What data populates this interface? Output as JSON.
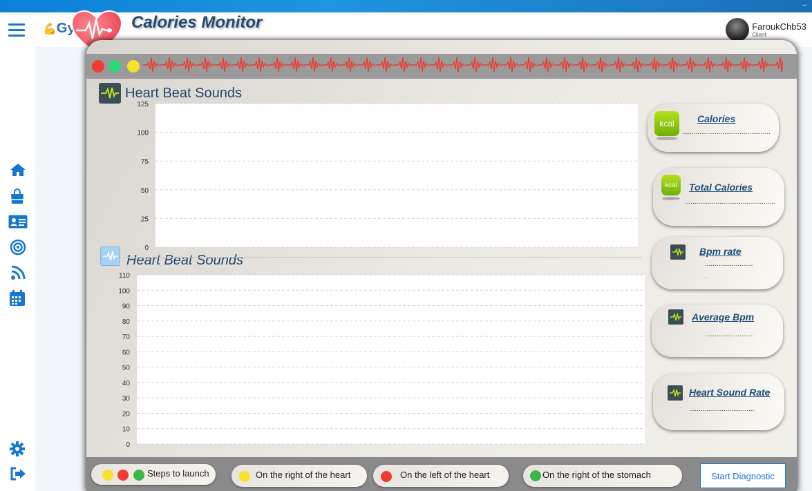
{
  "app": {
    "name": "GymRats",
    "title": "Calories Monitor"
  },
  "user": {
    "name": "FaroukChb53",
    "role": "Client"
  },
  "nav": {
    "items": [
      "menu-icon",
      "home-icon",
      "shop-bag-icon",
      "id-card-icon",
      "target-icon",
      "rss-icon",
      "calendar-icon",
      "settings-icon",
      "logout-icon"
    ]
  },
  "charts": [
    {
      "title": "Heart Beat Sounds"
    },
    {
      "title": "Heart Beat Sounds"
    }
  ],
  "chart_data": [
    {
      "type": "line",
      "title": "Heart Beat Sounds",
      "ylim": [
        0,
        125
      ],
      "yticks": [
        "0",
        "25",
        "50",
        "75",
        "100",
        "125"
      ],
      "series": [],
      "grid": true
    },
    {
      "type": "line",
      "title": "Heart Beat Sounds",
      "ylim": [
        0,
        110
      ],
      "yticks": [
        "0",
        "10",
        "20",
        "30",
        "40",
        "50",
        "60",
        "70",
        "80",
        "90",
        "100",
        "110"
      ],
      "series": [],
      "grid": true
    }
  ],
  "cards": [
    {
      "label": "Calories ",
      "value": "..............................................",
      "icon": "kcal"
    },
    {
      "label": "Total Calories",
      "value": "...............................................",
      "icon": "kcal"
    },
    {
      "label": "Bpm rate ",
      "value": ".........................",
      "value2": ".",
      "icon": "pulse"
    },
    {
      "label": "Average Bpm",
      "value": ".........................",
      "icon": "pulse"
    },
    {
      "label": "Heart Sound Rate",
      "value": "..................................",
      "icon": "pulse"
    }
  ],
  "legend": {
    "steps": "Steps to launch",
    "right_heart": "On the right of the heart",
    "left_heart": "On the left of the heart",
    "right_stomach": "On the right of the stomach"
  },
  "buttons": {
    "start": "Start Diagnostic"
  },
  "colors": {
    "red": "#f03a32",
    "green": "#2ed67a",
    "yellow": "#f7e22a",
    "green_dot": "#3cb54a",
    "accent": "#1677cf"
  },
  "window_dots": [
    "red",
    "green",
    "yellow"
  ]
}
